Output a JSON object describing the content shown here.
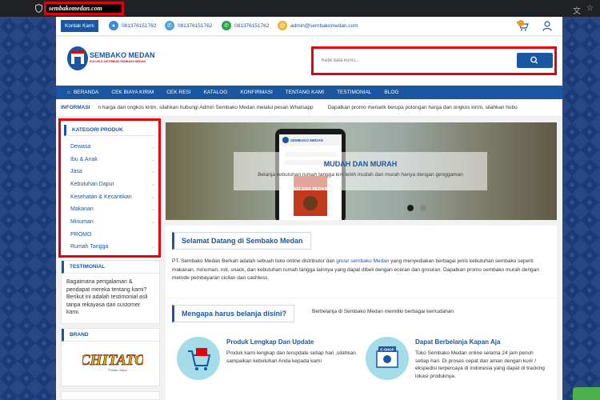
{
  "browser": {
    "url": "sembakomedan.com"
  },
  "topbar": {
    "kontak": "Kontak Kami",
    "phone1": "081376151762",
    "phone2": "081376151762",
    "whatsapp": "081376151762",
    "email": "admin@sembakomedan.com"
  },
  "logo": {
    "title": "SEMBAKO MEDAN",
    "tagline": "SOLUSI & DISTRIBUSI SEMBAKO MEDAN"
  },
  "search": {
    "placeholder": "Ketik kata kunci..."
  },
  "nav": [
    "BERANDA",
    "CEK BIAYA KIRIM",
    "CEK RESI",
    "KATALOG",
    "KONFIRMASI",
    "TENTANG KAMI",
    "TESTIMONIAL",
    "BLOG"
  ],
  "info": {
    "label": "INFORMASI",
    "text": "n harga dan ongkos kirim, silahkan hubungi Admin Sembako Medan melalui pesan Whatsapp",
    "text2": "Dapatkan promo menarik berupa potongan harga dan ongkos kirim, silahkan hubu"
  },
  "categories": {
    "title": "KATEGORI PRODUK",
    "items": [
      "Dewasa",
      "Ibu & Anak",
      "Jasa",
      "Kebutuhan Dapur",
      "Kesehatan & Kecantikan",
      "Makanan",
      "Minuman",
      "PROMO",
      "Rumah Tangga"
    ]
  },
  "testimonial": {
    "title": "TESTIMONIAL",
    "text": "Bagaimana pengalaman & pendapat mereka tentang kami? Berikut ini adalah testimonial asli tanpa rekayasa dari customer kami."
  },
  "brand": {
    "title": "BRAND",
    "logo_text": "CHITATO",
    "logo_sub": "Potato Chips"
  },
  "hero": {
    "title": "MUDAH DAN MURAH",
    "subtitle": "Belanja kebutuhan rumah tangga kini lebih mudah dan murah hanya dengan genggaman",
    "phone_brand": "SEMBAKO MEDAN",
    "phone_product": "SELERA PEDAS"
  },
  "welcome": {
    "title": "Selamat Datang di Sembako Medan",
    "text_a": "PT. Sembako Medan Berkah adalah sebuah toko online distributor dan ",
    "link": "grosir sembako Medan",
    "text_b": " yang menyediakan berbagai jenis kebutuhan sembako seperti makanan, minuman, roti, snack, dan kebutuhan rumah tangga lainnya yang dapat dibeli dengan eceran dan grosiran. Dapatkan promo sembako murah dengan metode pembayaran cicilan dan cashless."
  },
  "why": {
    "title": "Mengapa harus belanja disini?",
    "subtitle": "Berbelanja di Sembako Medan memiliki berbagai kemudahan",
    "features": [
      {
        "title": "Produk Lengkap Dan Update",
        "desc": "Produk kami lengkap dan terupdate setiap hari ,silahkan sampaikan kebutuhan Anda kepada kami"
      },
      {
        "title": "Dapat Berbelanja Kapan Aja",
        "desc": "Toko Sembako Medan online selama 24 jam penuh setiap hari. Di proses cepat dan aman dengan kurir / ekspedisi terpercaya di Indonesia yang dapat di tracking lokasi produknya."
      }
    ],
    "eshop_label": "E-SHOP"
  },
  "colors": {
    "primary": "#1a57a0",
    "highlight": "#e3000f",
    "background": "#1a3a7a"
  }
}
